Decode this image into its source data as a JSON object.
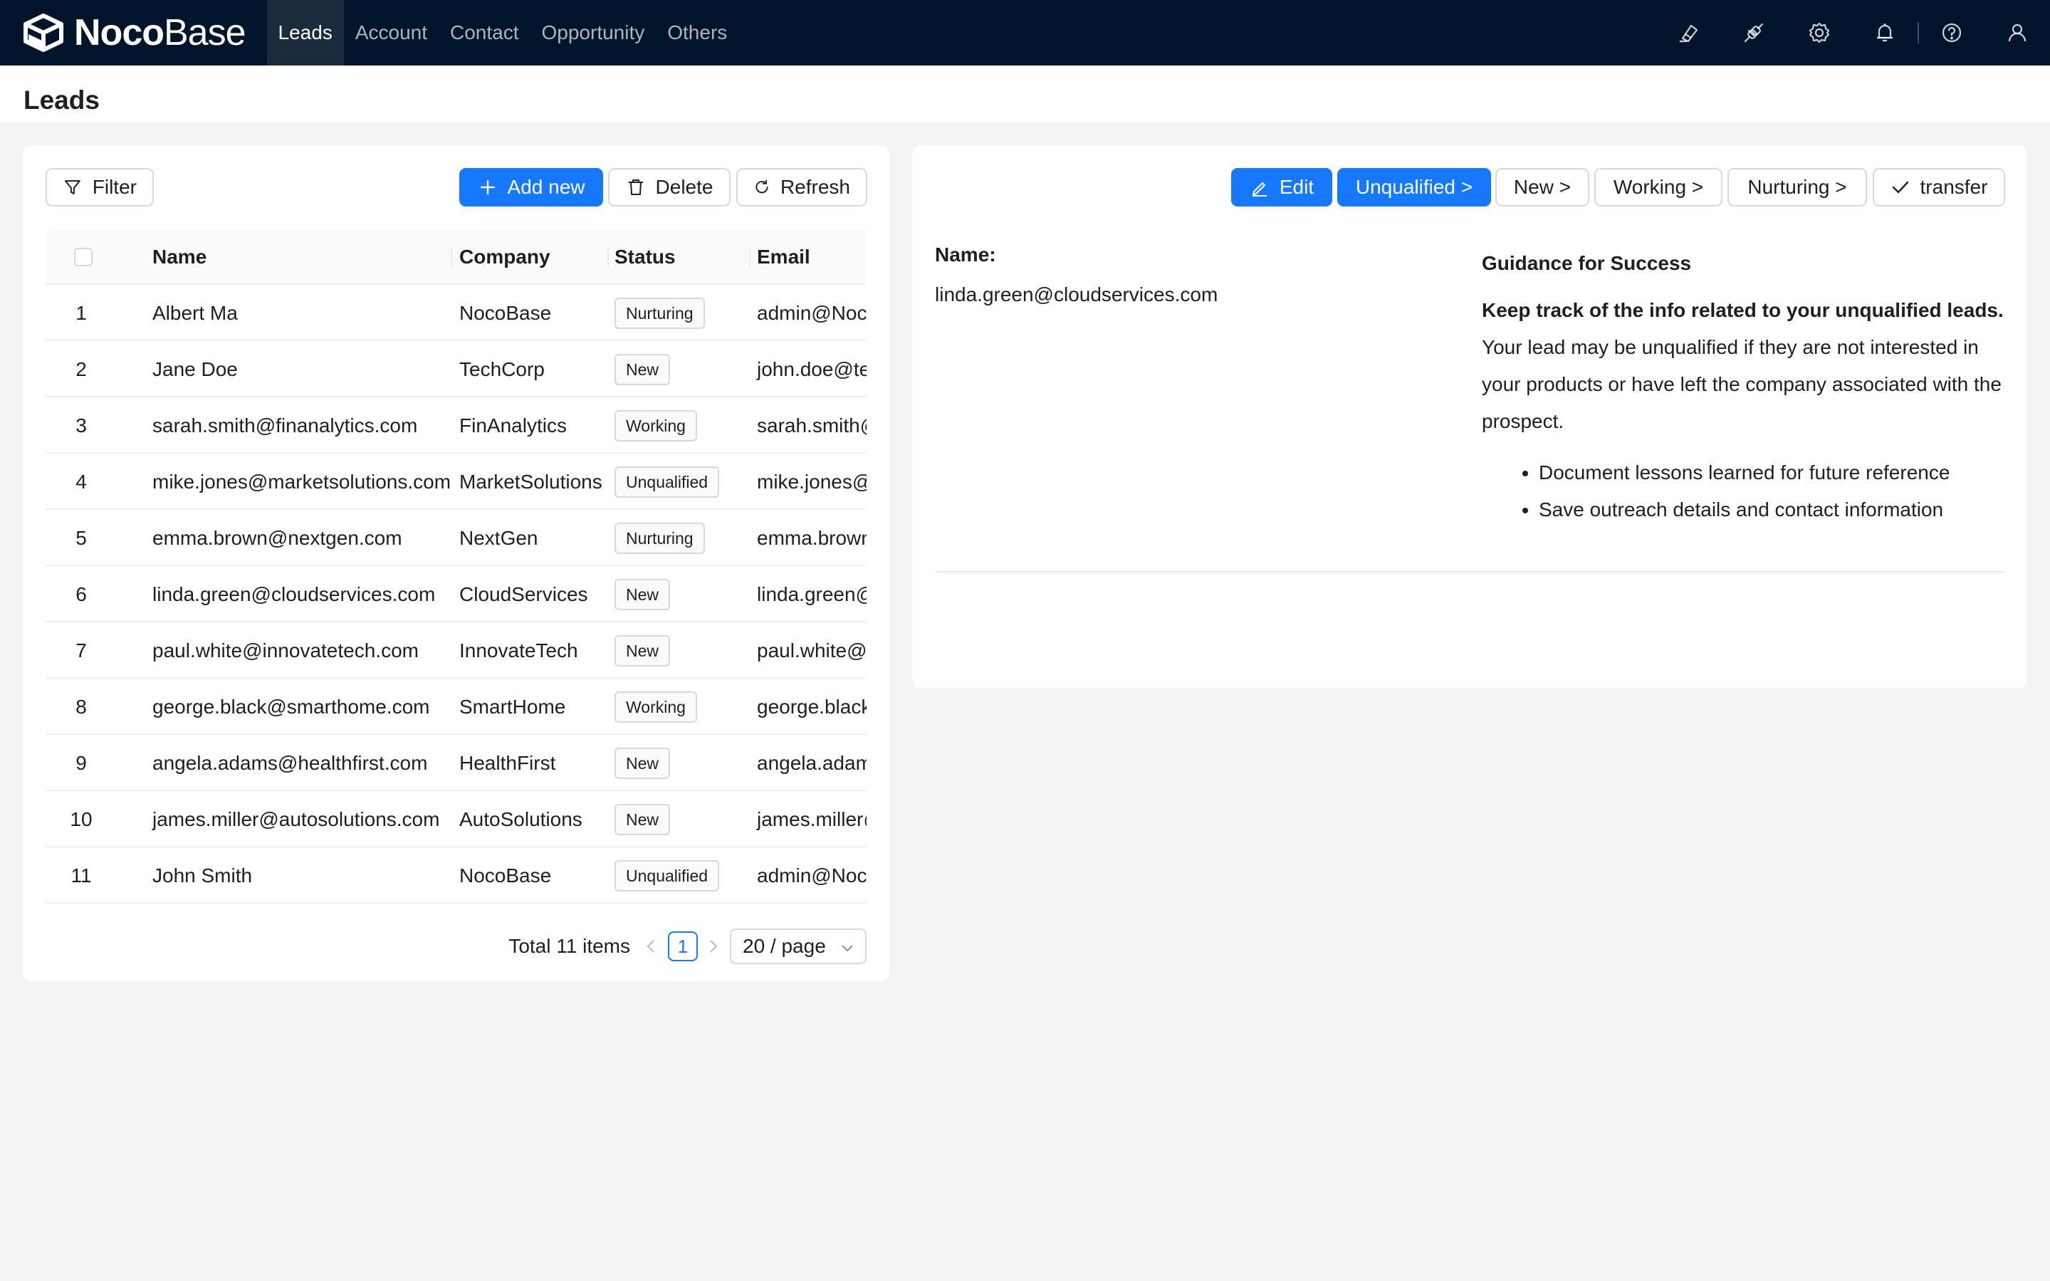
{
  "app": {
    "brand_bold": "Noco",
    "brand_light": "Base"
  },
  "nav": {
    "items": [
      {
        "label": "Leads",
        "active": true
      },
      {
        "label": "Account"
      },
      {
        "label": "Contact"
      },
      {
        "label": "Opportunity"
      },
      {
        "label": "Others"
      }
    ]
  },
  "top_icons": [
    "highlight-icon",
    "plugin-icon",
    "settings-icon",
    "bell-icon",
    "help-icon",
    "user-icon"
  ],
  "page": {
    "title": "Leads"
  },
  "toolbar": {
    "filter": "Filter",
    "add_new": "Add new",
    "delete": "Delete",
    "refresh": "Refresh"
  },
  "table": {
    "columns": [
      "Name",
      "Company",
      "Status",
      "Email"
    ],
    "rows": [
      {
        "idx": "1",
        "name": "Albert Ma",
        "company": "NocoBase",
        "status": "Nurturing",
        "email": "admin@NocoBase.com"
      },
      {
        "idx": "2",
        "name": "Jane Doe",
        "company": "TechCorp",
        "status": "New",
        "email": "john.doe@techcorp.com"
      },
      {
        "idx": "3",
        "name": "sarah.smith@finanalytics.com",
        "company": "FinAnalytics",
        "status": "Working",
        "email": "sarah.smith@finanalytics.com"
      },
      {
        "idx": "4",
        "name": "mike.jones@marketsolutions.com",
        "company": "MarketSolutions",
        "status": "Unqualified",
        "email": "mike.jones@marketsolutions.com"
      },
      {
        "idx": "5",
        "name": "emma.brown@nextgen.com",
        "company": "NextGen",
        "status": "Nurturing",
        "email": "emma.brown@nextgen.com"
      },
      {
        "idx": "6",
        "name": "linda.green@cloudservices.com",
        "company": "CloudServices",
        "status": "New",
        "email": "linda.green@cloudservices.com"
      },
      {
        "idx": "7",
        "name": "paul.white@innovatetech.com",
        "company": "InnovateTech",
        "status": "New",
        "email": "paul.white@innovatetech.com"
      },
      {
        "idx": "8",
        "name": "george.black@smarthome.com",
        "company": "SmartHome",
        "status": "Working",
        "email": "george.black@smarthome.com"
      },
      {
        "idx": "9",
        "name": "angela.adams@healthfirst.com",
        "company": "HealthFirst",
        "status": "New",
        "email": "angela.adams@healthfirst.com"
      },
      {
        "idx": "10",
        "name": "james.miller@autosolutions.com",
        "company": "AutoSolutions",
        "status": "New",
        "email": "james.miller@autosolutions.com"
      },
      {
        "idx": "11",
        "name": "John Smith",
        "company": "NocoBase",
        "status": "Unqualified",
        "email": "admin@NocoBase.com"
      }
    ]
  },
  "pagination": {
    "total": "Total 11 items",
    "current": "1",
    "page_size": "20 / page"
  },
  "detail": {
    "actions": {
      "edit": "Edit",
      "unqualified": "Unqualified >",
      "new": "New >",
      "working": "Working >",
      "nurturing": "Nurturing >",
      "transfer": "transfer"
    },
    "name_label": "Name:",
    "name_value": "linda.green@cloudservices.com",
    "guide_title": "Guidance for Success",
    "guide_strong": "Keep track of the info related to your unqualified leads.",
    "guide_text": "Your lead may be unqualified if they are not interested in your products or have left the company associated with the prospect.",
    "guide_bullets": [
      "Document lessons learned for future reference",
      "Save outreach details and contact information"
    ]
  },
  "colors": {
    "topbar": "#001529",
    "primary": "#1677ff"
  }
}
